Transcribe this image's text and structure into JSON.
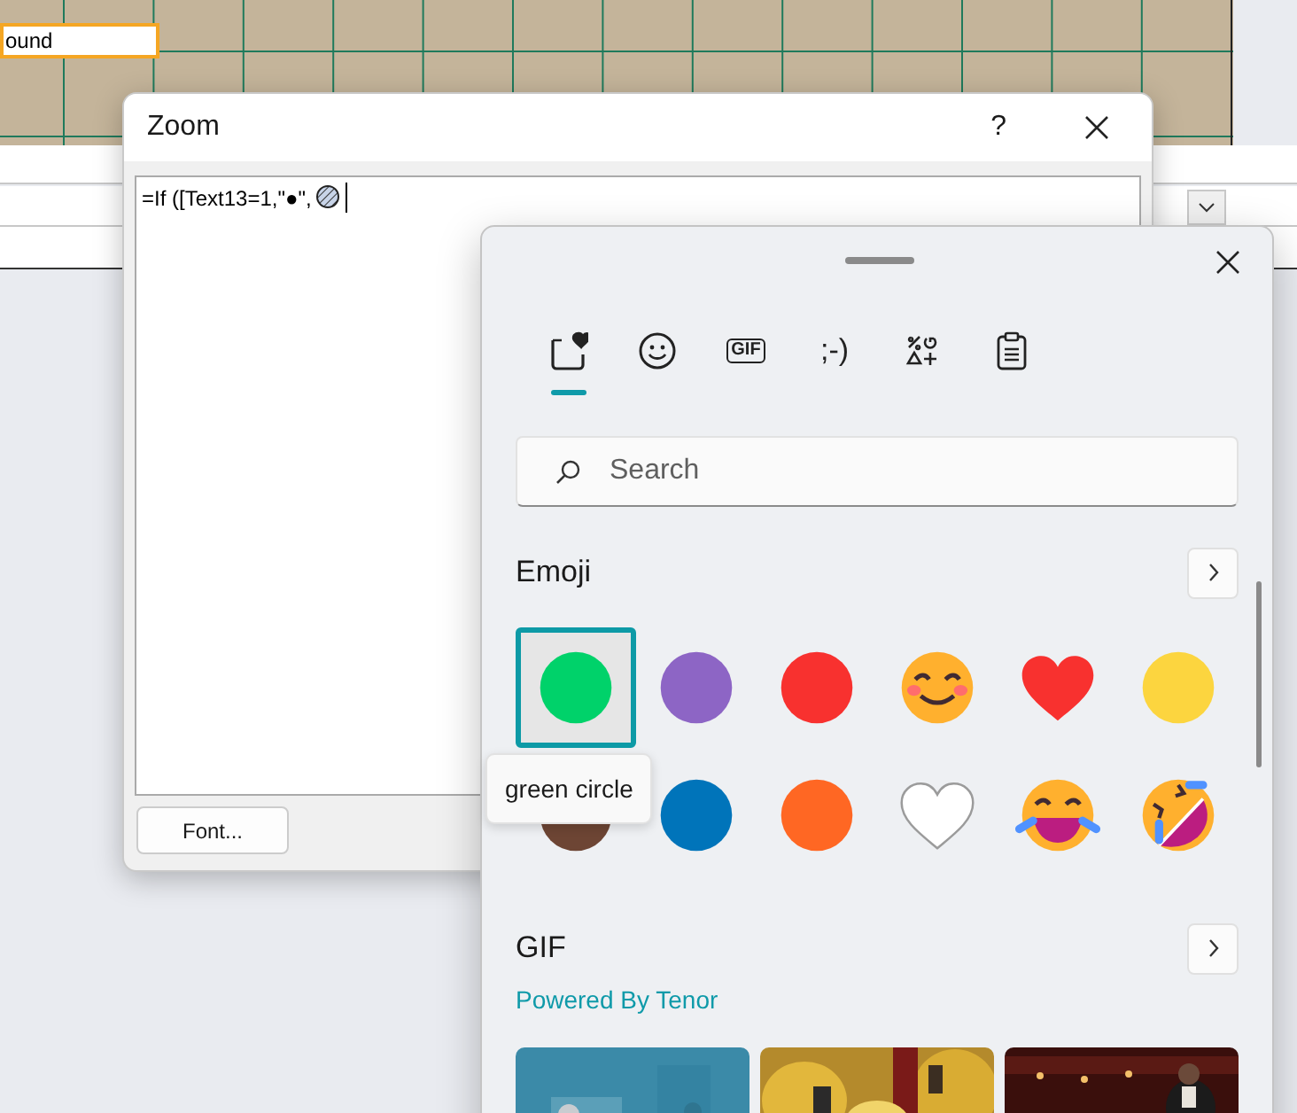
{
  "background": {
    "field_text": "ound"
  },
  "zoom_dialog": {
    "title": "Zoom",
    "help": "?",
    "expression": "=If ([Text13=1,\"●\",",
    "font_button": "Font..."
  },
  "emoji_panel": {
    "tabs": [
      {
        "kind": "favorites",
        "selected": true
      },
      {
        "kind": "emoji",
        "selected": false
      },
      {
        "kind": "gif",
        "label": "GIF",
        "selected": false
      },
      {
        "kind": "kaomoji",
        "label": ";-)",
        "selected": false
      },
      {
        "kind": "symbols",
        "selected": false
      },
      {
        "kind": "clipboard",
        "selected": false
      }
    ],
    "search": {
      "placeholder": "Search"
    },
    "emoji_section": {
      "title": "Emoji",
      "items": [
        {
          "kind": "circle",
          "color": "#00d26a",
          "selected": true
        },
        {
          "kind": "circle",
          "color": "#8d65c5",
          "selected": false
        },
        {
          "kind": "circle",
          "color": "#f8312f",
          "selected": false
        },
        {
          "kind": "smile",
          "selected": false
        },
        {
          "kind": "heart",
          "selected": false
        },
        {
          "kind": "circle",
          "color": "#fcd53f",
          "selected": false
        },
        {
          "kind": "circle",
          "color": "#6d4534",
          "selected": false
        },
        {
          "kind": "circle",
          "color": "#0074ba",
          "selected": false
        },
        {
          "kind": "circle",
          "color": "#ff6723",
          "selected": false
        },
        {
          "kind": "white_heart",
          "selected": false
        },
        {
          "kind": "joy",
          "selected": false
        },
        {
          "kind": "rofl",
          "selected": false
        }
      ]
    },
    "tooltip": "green circle",
    "gif_section": {
      "title": "GIF",
      "credit": "Powered By Tenor"
    }
  }
}
